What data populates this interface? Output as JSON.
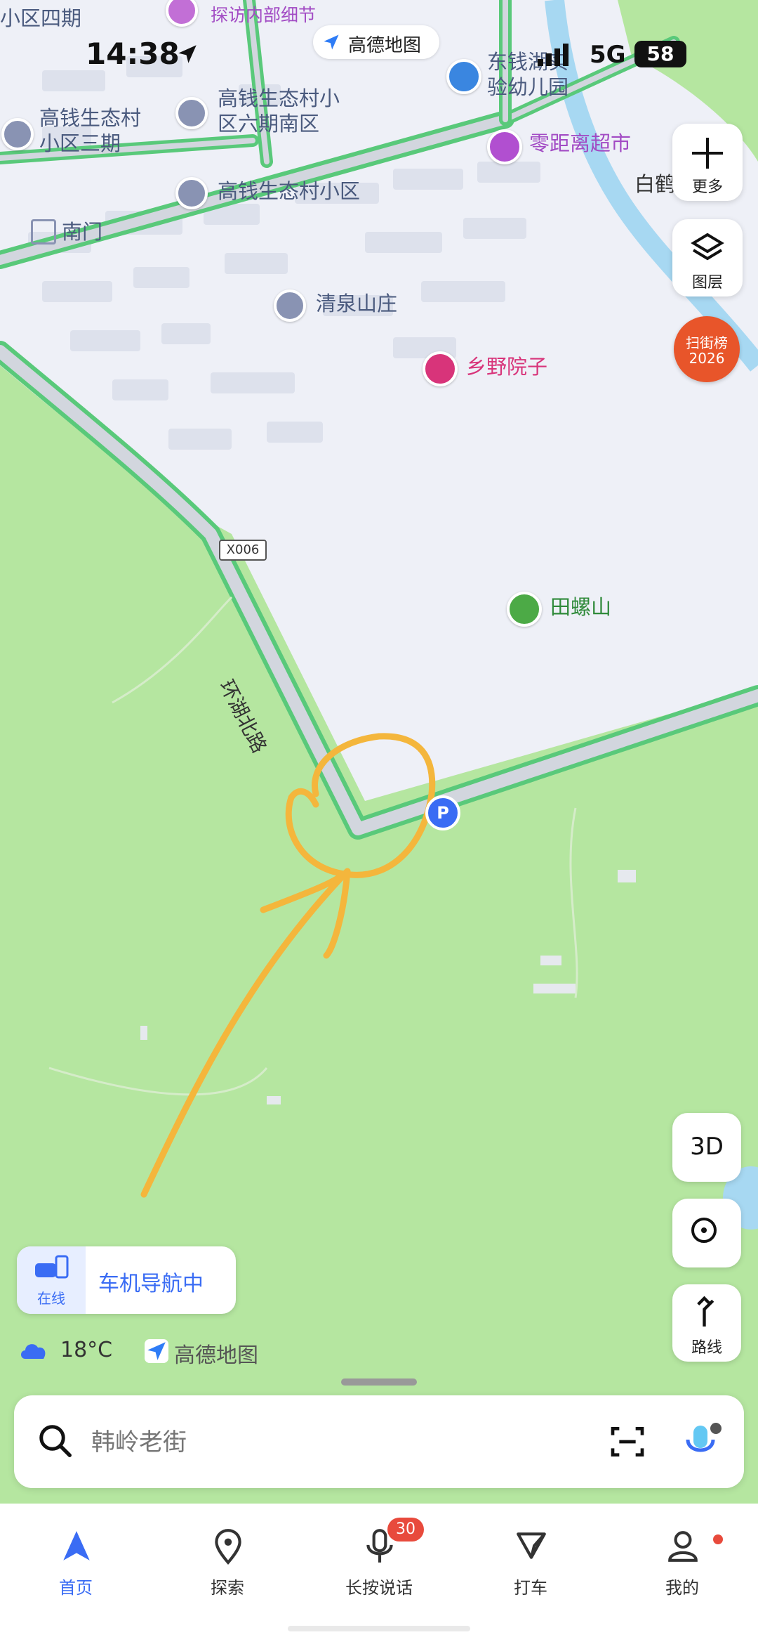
{
  "status_bar": {
    "time": "14:38",
    "network": "5G",
    "battery": "58"
  },
  "brand": {
    "name": "高德地图"
  },
  "map_labels": {
    "xiaoqu_siqi": "小区四期",
    "tanfang": "探访内部细节",
    "gaoqian_sanqi": "高钱生态村\n小区三期",
    "gaoqian_liuqi": "高钱生态村小\n区六期南区",
    "gaoqian": "高钱生态村小区",
    "nanmen": "南门",
    "qingquan": "清泉山庄",
    "xiangye": "乡野院子",
    "dongqian": "东钱湖实\n验幼儿园",
    "lingjuli": "零距离超市",
    "baihe": "白鹤",
    "road_code": "X006",
    "road_name": "环湖北路",
    "tianluoshan": "田螺山"
  },
  "right_controls": {
    "more_label": "更多",
    "layers_label": "图层",
    "ranking_label": "扫街榜",
    "ranking_year": "2026",
    "3d_label": "3D",
    "route_label": "路线"
  },
  "nav_card": {
    "badge": "在线",
    "text": "车机导航中"
  },
  "weather": {
    "temp": "18°C"
  },
  "search": {
    "placeholder": "韩岭老街"
  },
  "tabs": [
    {
      "label": "首页"
    },
    {
      "label": "探索"
    },
    {
      "label": "长按说话",
      "badge": "30"
    },
    {
      "label": "打车"
    },
    {
      "label": "我的"
    }
  ],
  "colors": {
    "accent": "#3a6cf4",
    "green_area": "#b5e6a0",
    "road_green": "#59c97a",
    "annotation": "#f4b63c",
    "badge_red": "#e84a3c"
  }
}
